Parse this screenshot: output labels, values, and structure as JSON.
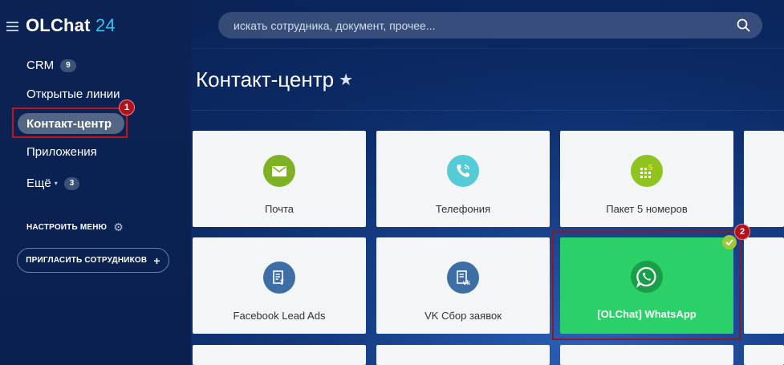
{
  "app": {
    "logo_name": "OLChat",
    "logo_number": "24"
  },
  "sidebar": {
    "items": [
      {
        "label": "CRM",
        "counter": "9"
      },
      {
        "label": "Открытые линии"
      },
      {
        "label": "Контакт-центр",
        "active": true
      },
      {
        "label": "Приложения"
      },
      {
        "label": "Ещё",
        "counter": "3"
      }
    ],
    "settings_label": "НАСТРОИТЬ МЕНЮ",
    "invite_label": "ПРИГЛАСИТЬ СОТРУДНИКОВ"
  },
  "search": {
    "placeholder": "искать сотрудника, документ, прочее..."
  },
  "page": {
    "title": "Контакт-центр"
  },
  "tiles": [
    {
      "label": "Почта",
      "icon": "mail-icon",
      "color": "#7fb125"
    },
    {
      "label": "Телефония",
      "icon": "phone-icon",
      "color": "#55cbd8"
    },
    {
      "label": "Пакет 5 номеров",
      "icon": "grid-5-icon",
      "color": "#8fc31f"
    },
    {
      "label": "Facebook Lead Ads",
      "icon": "facebook-form-icon",
      "color": "#3d6ea5"
    },
    {
      "label": "VK Сбор заявок",
      "icon": "vk-form-icon",
      "color": "#3d6ea5"
    },
    {
      "label": "[OLChat] WhatsApp",
      "icon": "whatsapp-icon",
      "color": "#2bd068",
      "connected": true
    }
  ],
  "annotations": {
    "marker1": "1",
    "marker2": "2"
  }
}
